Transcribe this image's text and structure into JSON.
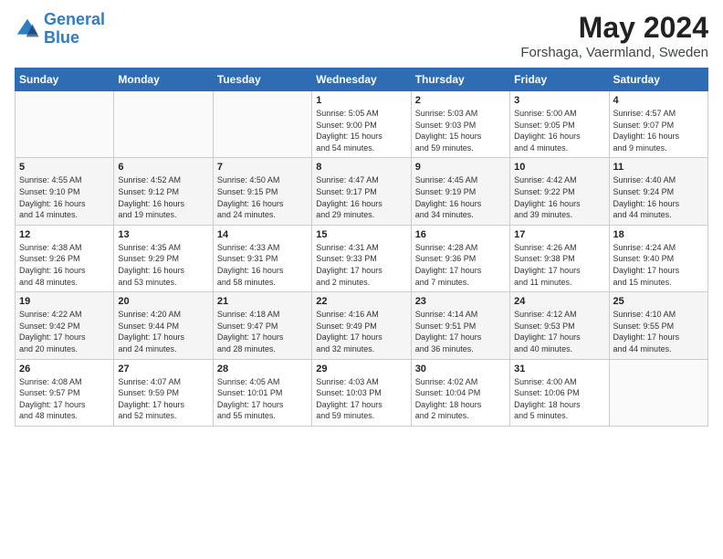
{
  "header": {
    "logo_line1": "General",
    "logo_line2": "Blue",
    "main_title": "May 2024",
    "subtitle": "Forshaga, Vaermland, Sweden"
  },
  "weekdays": [
    "Sunday",
    "Monday",
    "Tuesday",
    "Wednesday",
    "Thursday",
    "Friday",
    "Saturday"
  ],
  "weeks": [
    [
      {
        "day": "",
        "info": ""
      },
      {
        "day": "",
        "info": ""
      },
      {
        "day": "",
        "info": ""
      },
      {
        "day": "1",
        "info": "Sunrise: 5:05 AM\nSunset: 9:00 PM\nDaylight: 15 hours\nand 54 minutes."
      },
      {
        "day": "2",
        "info": "Sunrise: 5:03 AM\nSunset: 9:03 PM\nDaylight: 15 hours\nand 59 minutes."
      },
      {
        "day": "3",
        "info": "Sunrise: 5:00 AM\nSunset: 9:05 PM\nDaylight: 16 hours\nand 4 minutes."
      },
      {
        "day": "4",
        "info": "Sunrise: 4:57 AM\nSunset: 9:07 PM\nDaylight: 16 hours\nand 9 minutes."
      }
    ],
    [
      {
        "day": "5",
        "info": "Sunrise: 4:55 AM\nSunset: 9:10 PM\nDaylight: 16 hours\nand 14 minutes."
      },
      {
        "day": "6",
        "info": "Sunrise: 4:52 AM\nSunset: 9:12 PM\nDaylight: 16 hours\nand 19 minutes."
      },
      {
        "day": "7",
        "info": "Sunrise: 4:50 AM\nSunset: 9:15 PM\nDaylight: 16 hours\nand 24 minutes."
      },
      {
        "day": "8",
        "info": "Sunrise: 4:47 AM\nSunset: 9:17 PM\nDaylight: 16 hours\nand 29 minutes."
      },
      {
        "day": "9",
        "info": "Sunrise: 4:45 AM\nSunset: 9:19 PM\nDaylight: 16 hours\nand 34 minutes."
      },
      {
        "day": "10",
        "info": "Sunrise: 4:42 AM\nSunset: 9:22 PM\nDaylight: 16 hours\nand 39 minutes."
      },
      {
        "day": "11",
        "info": "Sunrise: 4:40 AM\nSunset: 9:24 PM\nDaylight: 16 hours\nand 44 minutes."
      }
    ],
    [
      {
        "day": "12",
        "info": "Sunrise: 4:38 AM\nSunset: 9:26 PM\nDaylight: 16 hours\nand 48 minutes."
      },
      {
        "day": "13",
        "info": "Sunrise: 4:35 AM\nSunset: 9:29 PM\nDaylight: 16 hours\nand 53 minutes."
      },
      {
        "day": "14",
        "info": "Sunrise: 4:33 AM\nSunset: 9:31 PM\nDaylight: 16 hours\nand 58 minutes."
      },
      {
        "day": "15",
        "info": "Sunrise: 4:31 AM\nSunset: 9:33 PM\nDaylight: 17 hours\nand 2 minutes."
      },
      {
        "day": "16",
        "info": "Sunrise: 4:28 AM\nSunset: 9:36 PM\nDaylight: 17 hours\nand 7 minutes."
      },
      {
        "day": "17",
        "info": "Sunrise: 4:26 AM\nSunset: 9:38 PM\nDaylight: 17 hours\nand 11 minutes."
      },
      {
        "day": "18",
        "info": "Sunrise: 4:24 AM\nSunset: 9:40 PM\nDaylight: 17 hours\nand 15 minutes."
      }
    ],
    [
      {
        "day": "19",
        "info": "Sunrise: 4:22 AM\nSunset: 9:42 PM\nDaylight: 17 hours\nand 20 minutes."
      },
      {
        "day": "20",
        "info": "Sunrise: 4:20 AM\nSunset: 9:44 PM\nDaylight: 17 hours\nand 24 minutes."
      },
      {
        "day": "21",
        "info": "Sunrise: 4:18 AM\nSunset: 9:47 PM\nDaylight: 17 hours\nand 28 minutes."
      },
      {
        "day": "22",
        "info": "Sunrise: 4:16 AM\nSunset: 9:49 PM\nDaylight: 17 hours\nand 32 minutes."
      },
      {
        "day": "23",
        "info": "Sunrise: 4:14 AM\nSunset: 9:51 PM\nDaylight: 17 hours\nand 36 minutes."
      },
      {
        "day": "24",
        "info": "Sunrise: 4:12 AM\nSunset: 9:53 PM\nDaylight: 17 hours\nand 40 minutes."
      },
      {
        "day": "25",
        "info": "Sunrise: 4:10 AM\nSunset: 9:55 PM\nDaylight: 17 hours\nand 44 minutes."
      }
    ],
    [
      {
        "day": "26",
        "info": "Sunrise: 4:08 AM\nSunset: 9:57 PM\nDaylight: 17 hours\nand 48 minutes."
      },
      {
        "day": "27",
        "info": "Sunrise: 4:07 AM\nSunset: 9:59 PM\nDaylight: 17 hours\nand 52 minutes."
      },
      {
        "day": "28",
        "info": "Sunrise: 4:05 AM\nSunset: 10:01 PM\nDaylight: 17 hours\nand 55 minutes."
      },
      {
        "day": "29",
        "info": "Sunrise: 4:03 AM\nSunset: 10:03 PM\nDaylight: 17 hours\nand 59 minutes."
      },
      {
        "day": "30",
        "info": "Sunrise: 4:02 AM\nSunset: 10:04 PM\nDaylight: 18 hours\nand 2 minutes."
      },
      {
        "day": "31",
        "info": "Sunrise: 4:00 AM\nSunset: 10:06 PM\nDaylight: 18 hours\nand 5 minutes."
      },
      {
        "day": "",
        "info": ""
      }
    ]
  ]
}
